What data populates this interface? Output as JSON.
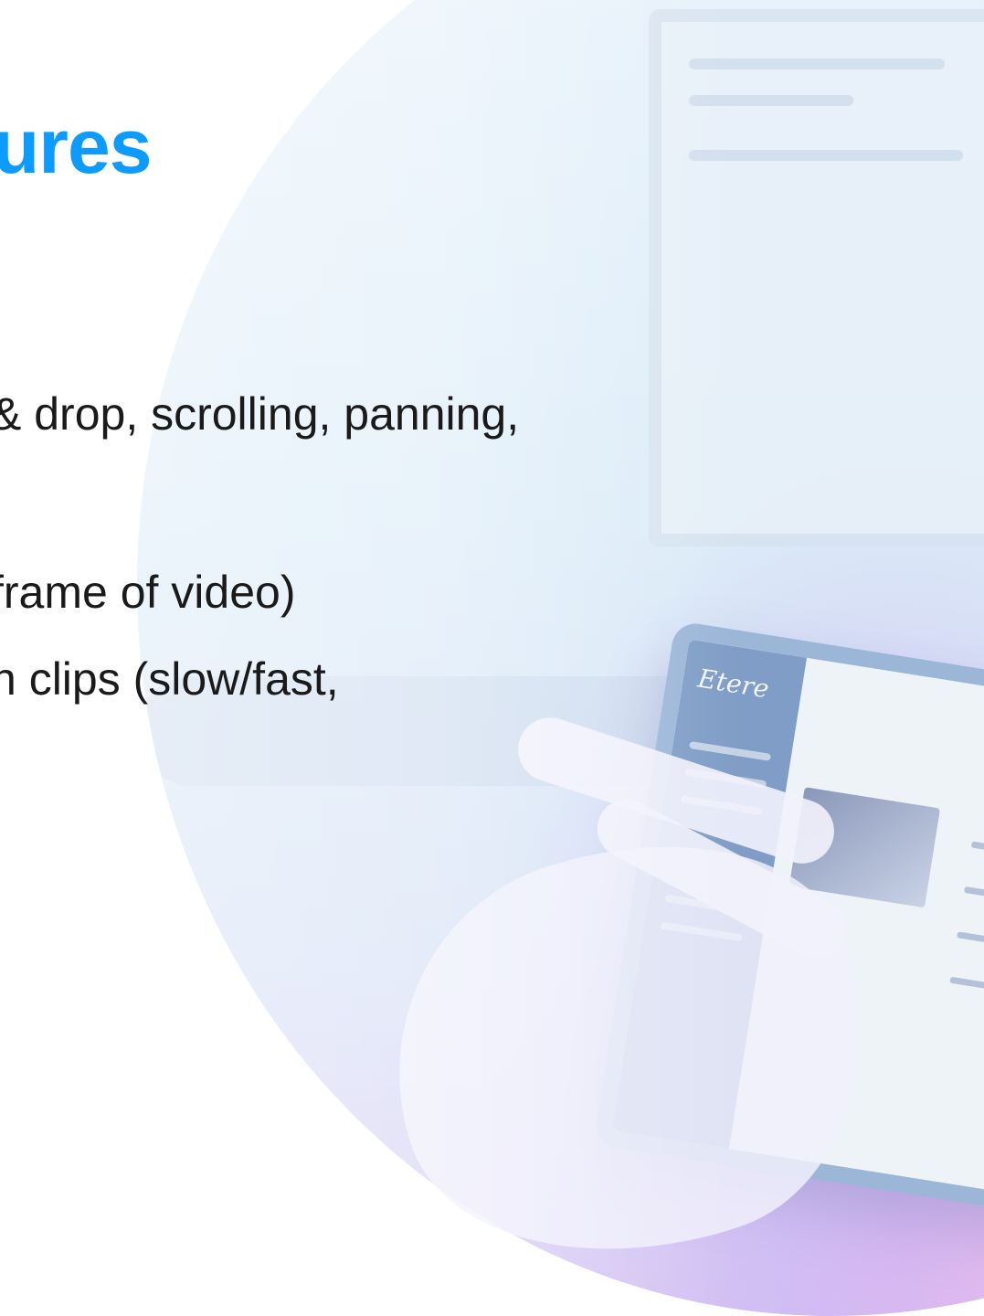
{
  "slide": {
    "title": "ures",
    "lines": [
      "& drop, scrolling, panning,",
      "frame of video)",
      "n clips (slow/fast,"
    ]
  },
  "tablet": {
    "brand": "Etere"
  },
  "colors": {
    "title": "#0d9bff",
    "body_text": "#1a1a1a",
    "circle_top": "#eaf3fb",
    "circle_bottom_pink": "#f3b6ea",
    "tablet_frame": "#9cb6d8"
  },
  "icons": [
    "tablet-device-image",
    "hand-image"
  ]
}
